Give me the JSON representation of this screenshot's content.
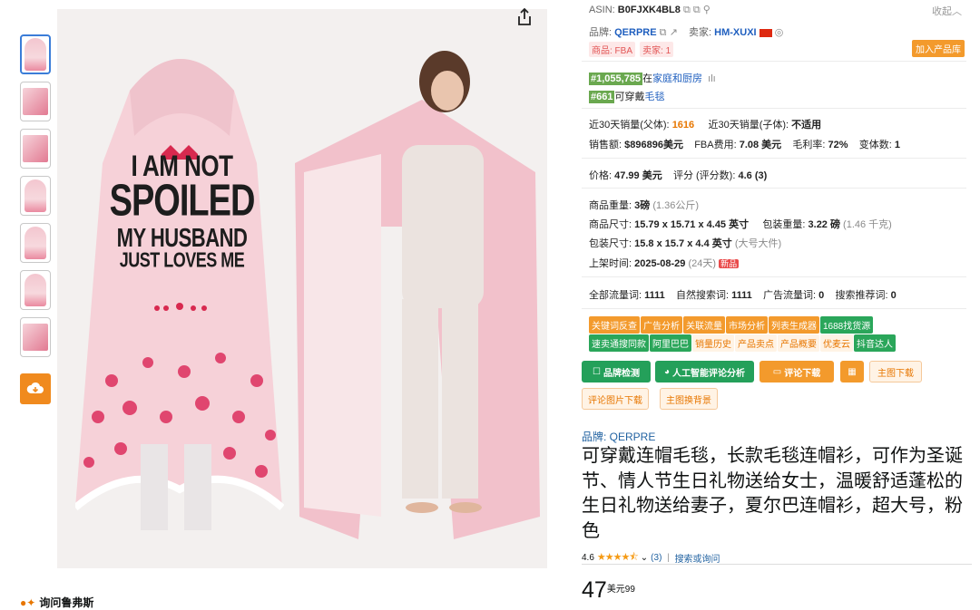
{
  "thumbnails": [
    "thumb-1",
    "thumb-2",
    "thumb-3",
    "thumb-4",
    "thumb-5",
    "thumb-6",
    "thumb-7"
  ],
  "main_image": {
    "slogan": [
      "I AM NOT",
      "SPOILED",
      "MY HUSBAND",
      "JUST LOVES ME"
    ]
  },
  "ask_label": "询问鲁弗斯",
  "panel": {
    "asin_label": "ASIN:",
    "asin": "B0FJXK4BL8",
    "collapse": "收起",
    "brand_label": "品牌:",
    "brand": "QERPRE",
    "seller_label": "卖家:",
    "seller": "HM-XUXI",
    "tag_source": "商品: FBA",
    "tag_sellers": "卖家: 1",
    "add_library": "加入产品库",
    "rank1": "#1,055,785",
    "rank1_in": "在",
    "rank1_cat": "家庭和厨房",
    "rank2": "#661",
    "rank2_in": "可穿戴",
    "rank2_cat": "毛毯",
    "sales30_parent_label": "近30天销量(父体):",
    "sales30_parent": "1616",
    "sales30_child_label": "近30天销量(子体):",
    "sales30_child": "不适用",
    "revenue_label": "销售额:",
    "revenue": "$896896美元",
    "fba_label": "FBA费用:",
    "fba": "7.08 美元",
    "margin_label": "毛利率:",
    "margin": "72%",
    "variants_label": "变体数:",
    "variants": "1",
    "price_label": "价格:",
    "price": "47.99 美元",
    "score_label": "评分 (评分数):",
    "score": "4.6 (3)",
    "weight_label": "商品重量:",
    "weight": "3磅",
    "weight_alt": "(1.36公斤)",
    "dims_label": "商品尺寸:",
    "dims": "15.79 x 15.71 x 4.45 英寸",
    "pkg_weight_label": "包装重量:",
    "pkg_weight": "3.22 磅",
    "pkg_weight_alt": "(1.46 千克)",
    "pkg_dims_label": "包装尺寸:",
    "pkg_dims": "15.8 x 15.7 x 4.4 英寸",
    "pkg_dims_alt": "(大号大件)",
    "listed_label": "上架时间:",
    "listed": "2025-08-29",
    "listed_alt": "(24天)",
    "new_badge": "新品",
    "traffic_all_label": "全部流量词:",
    "traffic_all": "1111",
    "traffic_natural_label": "自然搜索词:",
    "traffic_natural": "1111",
    "traffic_ad_label": "广告流量词:",
    "traffic_ad": "0",
    "traffic_rec_label": "搜索推荐词:",
    "traffic_rec": "0",
    "chips_row1": [
      {
        "label": "关键词反查",
        "style": "o"
      },
      {
        "label": "广告分析",
        "style": "o"
      },
      {
        "label": "关联流量",
        "style": "o"
      },
      {
        "label": "市场分析",
        "style": "o"
      },
      {
        "label": "列表生成器",
        "style": "o"
      },
      {
        "label": "1688找货源",
        "style": "g"
      }
    ],
    "chips_row2": [
      {
        "label": "速卖通搜同款",
        "style": "g"
      },
      {
        "label": "阿里巴巴",
        "style": "g"
      },
      {
        "label": "销量历史",
        "style": "l"
      },
      {
        "label": "产品卖点",
        "style": "l"
      },
      {
        "label": "产品概要",
        "style": "l"
      },
      {
        "label": "优麦云",
        "style": "l"
      },
      {
        "label": "抖音达人",
        "style": "g"
      }
    ],
    "btn_brand_check": "品牌检测",
    "btn_ai_review": "人工智能评论分析",
    "btn_review_dl": "评论下载",
    "btn_main_img_dl": "主图下载",
    "btn_review_img_dl": "评论图片下载",
    "btn_bg_replace": "主图换背景"
  },
  "product": {
    "brand_line": "品牌: QERPRE",
    "title": "可穿戴连帽毛毯，长款毛毯连帽衫，可作为圣诞节、情人节生日礼物送给女士，温暖舒适蓬松的生日礼物送给妻子，夏尔巴连帽衫，超大号，粉色",
    "rating_value": "4.6",
    "stars": "★★★★⯪",
    "rating_count": "(3)",
    "search_ask": "搜索或询问",
    "price_whole": "47",
    "price_fraction": "美元99"
  },
  "colors": {
    "accent_orange": "#f39a2c",
    "accent_green": "#24a05a",
    "link_blue": "#2162a1",
    "rank_green": "#6aa84f"
  }
}
